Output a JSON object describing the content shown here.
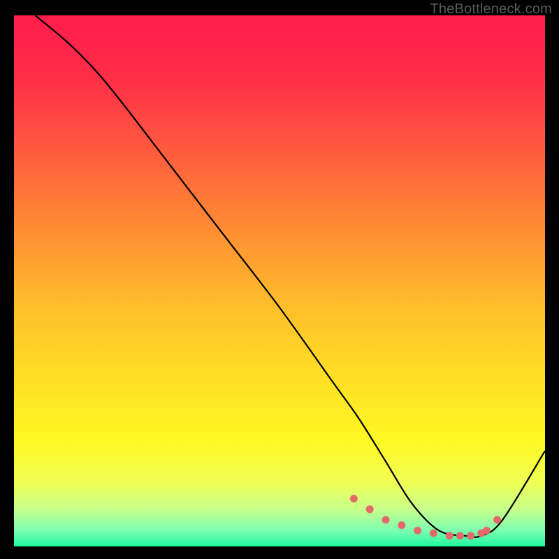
{
  "attribution": "TheBottleneck.com",
  "colors": {
    "black": "#000000",
    "curve": "#000000",
    "marker": "#e46a6a",
    "gradient_stops": [
      {
        "offset": 0.0,
        "color": "#ff1c4b"
      },
      {
        "offset": 0.12,
        "color": "#ff2e47"
      },
      {
        "offset": 0.25,
        "color": "#ff5a3e"
      },
      {
        "offset": 0.4,
        "color": "#ff8c33"
      },
      {
        "offset": 0.55,
        "color": "#ffbf2a"
      },
      {
        "offset": 0.7,
        "color": "#ffe324"
      },
      {
        "offset": 0.8,
        "color": "#fff823"
      },
      {
        "offset": 0.88,
        "color": "#f0ff55"
      },
      {
        "offset": 0.93,
        "color": "#c7ff8a"
      },
      {
        "offset": 0.97,
        "color": "#7dffb0"
      },
      {
        "offset": 1.0,
        "color": "#1ef7a0"
      }
    ]
  },
  "chart_data": {
    "type": "line",
    "title": "",
    "xlabel": "",
    "ylabel": "",
    "xlim": [
      0,
      100
    ],
    "ylim": [
      0,
      100
    ],
    "series": [
      {
        "name": "curve",
        "x": [
          4,
          10,
          15,
          20,
          30,
          40,
          50,
          60,
          65,
          70,
          75,
          80,
          85,
          88,
          92,
          100
        ],
        "values": [
          100,
          95,
          90,
          84,
          71,
          58,
          45,
          31,
          24,
          16,
          8,
          3,
          2,
          2,
          5,
          18
        ]
      }
    ],
    "markers": {
      "name": "optimal-region",
      "x": [
        64,
        67,
        70,
        73,
        76,
        79,
        82,
        84,
        86,
        88,
        89,
        91
      ],
      "values": [
        9,
        7,
        5,
        4,
        3,
        2.5,
        2,
        2,
        2,
        2.5,
        3,
        5
      ]
    }
  }
}
